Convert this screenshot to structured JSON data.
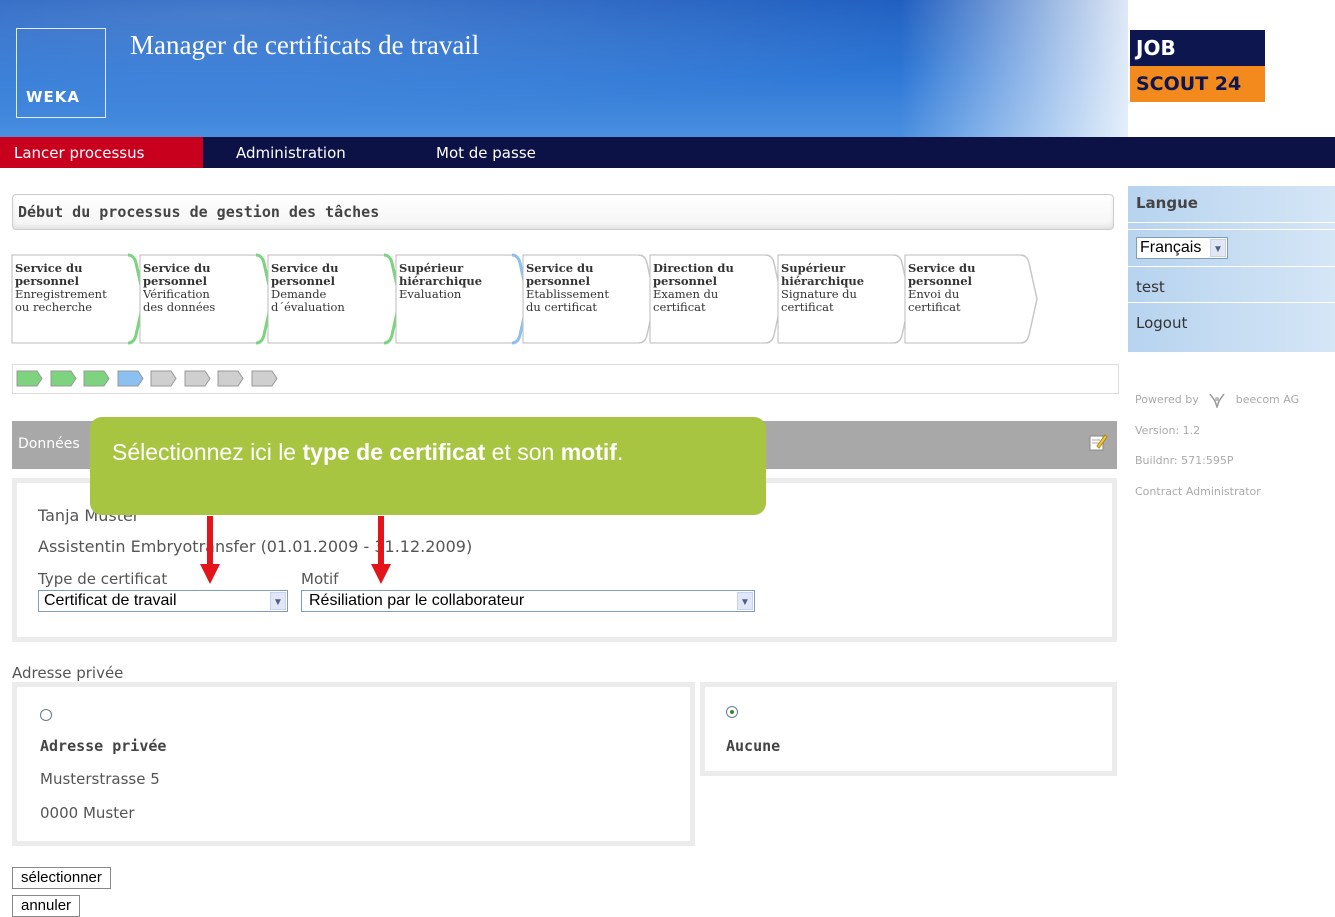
{
  "header": {
    "app_title": "Manager de certificats de travail",
    "weka_logo": "WEKA",
    "partner_logo_top": "JOB",
    "partner_logo_bottom": "SCOUT 24"
  },
  "nav": {
    "items": [
      "Lancer processus",
      "Administration",
      "Mot de passe"
    ],
    "active": "Lancer processus"
  },
  "sidebar": {
    "lang_title": "Langue",
    "lang_value": "Français",
    "user": "test",
    "logout": "Logout",
    "powered_by": "Powered by",
    "company": "beecom AG",
    "version": "Version: 1.2",
    "build": "Buildnr: 571:595P",
    "role": "Contract Administrator"
  },
  "process": {
    "title": "Début du processus de gestion des tâches",
    "steps": [
      {
        "l1": "Service du",
        "l2": "personnel",
        "l3": "Enregistrement",
        "l4": "ou recherche",
        "status": "done"
      },
      {
        "l1": "Service du",
        "l2": "personnel",
        "l3": "Vérification",
        "l4": "des données",
        "status": "done"
      },
      {
        "l1": "Service du",
        "l2": "personnel",
        "l3": "Demande",
        "l4": "d´évaluation",
        "status": "done"
      },
      {
        "l1": "Supérieur",
        "l2": "hiérarchique",
        "l3": "Evaluation",
        "l4": "",
        "status": "current"
      },
      {
        "l1": "Service du",
        "l2": "personnel",
        "l3": "Etablissement",
        "l4": "du certificat",
        "status": "todo"
      },
      {
        "l1": "Direction du",
        "l2": "personnel",
        "l3": "Examen du",
        "l4": "certificat",
        "status": "todo"
      },
      {
        "l1": "Supérieur",
        "l2": "hiérarchique",
        "l3": "Signature du",
        "l4": "certificat",
        "status": "todo"
      },
      {
        "l1": "Service du",
        "l2": "personnel",
        "l3": "Envoi du",
        "l4": "certificat",
        "status": "todo"
      }
    ],
    "colors": {
      "done": "#7ed37e",
      "current": "#8cc0f0",
      "todo": "#cfcfcf"
    }
  },
  "data_section": {
    "header": "Données",
    "employee_name": "Tanja Muster",
    "employee_job": "Assistentin Embryotransfer (01.01.2009 - 31.12.2009)",
    "type_label": "Type de certificat",
    "type_value": "Certificat de travail",
    "motif_label": "Motif",
    "motif_value": "Résiliation par le collaborateur"
  },
  "address": {
    "section_label": "Adresse privée",
    "option_title": "Adresse privée",
    "street": "Musterstrasse 5",
    "city": "0000 Muster",
    "none_label": "Aucune",
    "selected": "Aucune"
  },
  "buttons": {
    "select": "sélectionner",
    "cancel": "annuler"
  },
  "callout": {
    "part1": "Sélectionnez ici le ",
    "bold1": "type de certificat",
    "part2": " et son ",
    "bold2": "motif",
    "part3": "."
  }
}
